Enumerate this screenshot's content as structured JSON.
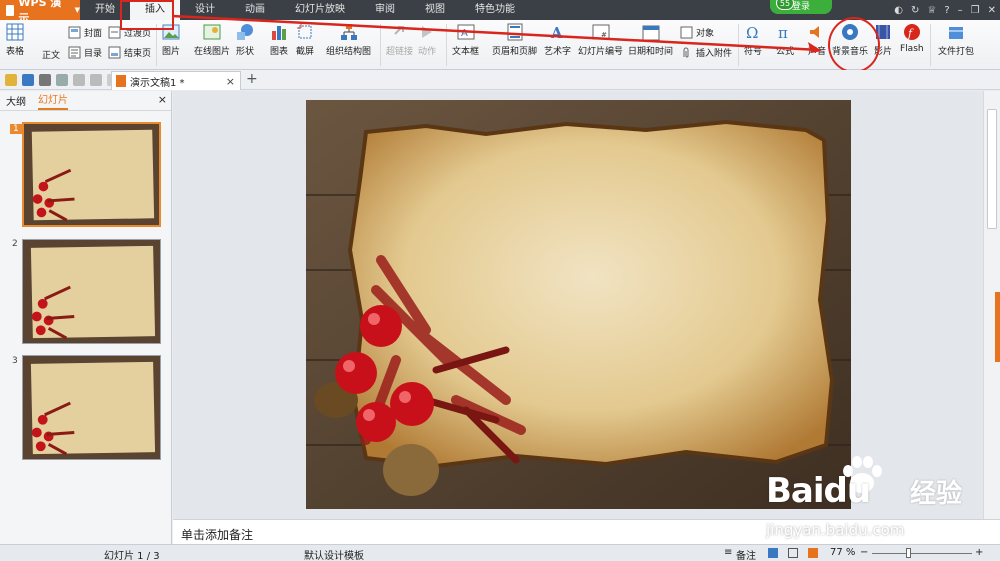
{
  "titlebar": {
    "app_name": "WPS 演示",
    "menu": [
      "开始",
      "插入",
      "设计",
      "动画",
      "幻灯片放映",
      "审阅",
      "视图",
      "特色功能"
    ],
    "active_menu": "插入",
    "login_label": "登录",
    "login_badge": "55",
    "help_label": "?"
  },
  "ribbon": {
    "table": "表格",
    "cover": "封面",
    "transition": "过渡页",
    "body_text": "正文",
    "toc": "目录",
    "end_page": "结束页",
    "picture": "图片",
    "online_picture": "在线图片",
    "shape": "形状",
    "chart": "图表",
    "screenshot": "截屏",
    "org_chart": "组织结构图",
    "hyperlink": "超链接",
    "action": "动作",
    "textbox": "文本框",
    "header_footer": "页眉和页脚",
    "wordart": "艺术字",
    "slide_number": "幻灯片编号",
    "date_time": "日期和时间",
    "object": "对象",
    "attachment": "插入附件",
    "symbol": "符号",
    "formula": "公式",
    "audio": "声音",
    "bg_music": "背景音乐",
    "video": "影片",
    "flash": "Flash",
    "package": "文件打包"
  },
  "tabs": {
    "doc_title": "演示文稿1 *",
    "close": "×",
    "new": "+"
  },
  "left_panel": {
    "tab_outline": "大纲",
    "tab_slides": "幻灯片",
    "close": "×",
    "slide_numbers": [
      "1",
      "2",
      "3"
    ]
  },
  "notes_placeholder": "单击添加备注",
  "status": {
    "slide_pos": "幻灯片 1 / 3",
    "template": "默认设计模板",
    "notes": "备注",
    "zoom": "77 %",
    "minus": "−",
    "plus": "+"
  },
  "watermark": {
    "brand": "Baidu",
    "cn": "经验",
    "url": "jingyan.baidu.com"
  },
  "colors": {
    "accent_orange": "#e8731f",
    "annotation_red": "#d9261c",
    "title_bar": "#3b4046"
  }
}
